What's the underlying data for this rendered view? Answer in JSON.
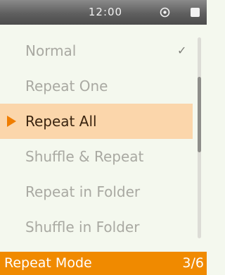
{
  "status_bar": {
    "time": "12:00",
    "icons": [
      "repeat-mode-icon",
      "battery-icon"
    ]
  },
  "menu": {
    "items": [
      {
        "label": "Normal",
        "checked": true
      },
      {
        "label": "Repeat One"
      },
      {
        "label": "Repeat All",
        "selected": true
      },
      {
        "label": "Shuffle & Repeat"
      },
      {
        "label": "Repeat in Folder"
      },
      {
        "label": "Shuffle in Folder"
      }
    ],
    "check_glyph": "✓"
  },
  "footer": {
    "title": "Repeat Mode",
    "position": "3/6"
  },
  "colors": {
    "accent": "#f08a00",
    "selection_bg": "#fbd6ab",
    "background": "#f4f8ee",
    "inactive_text": "#a9a9a2"
  }
}
